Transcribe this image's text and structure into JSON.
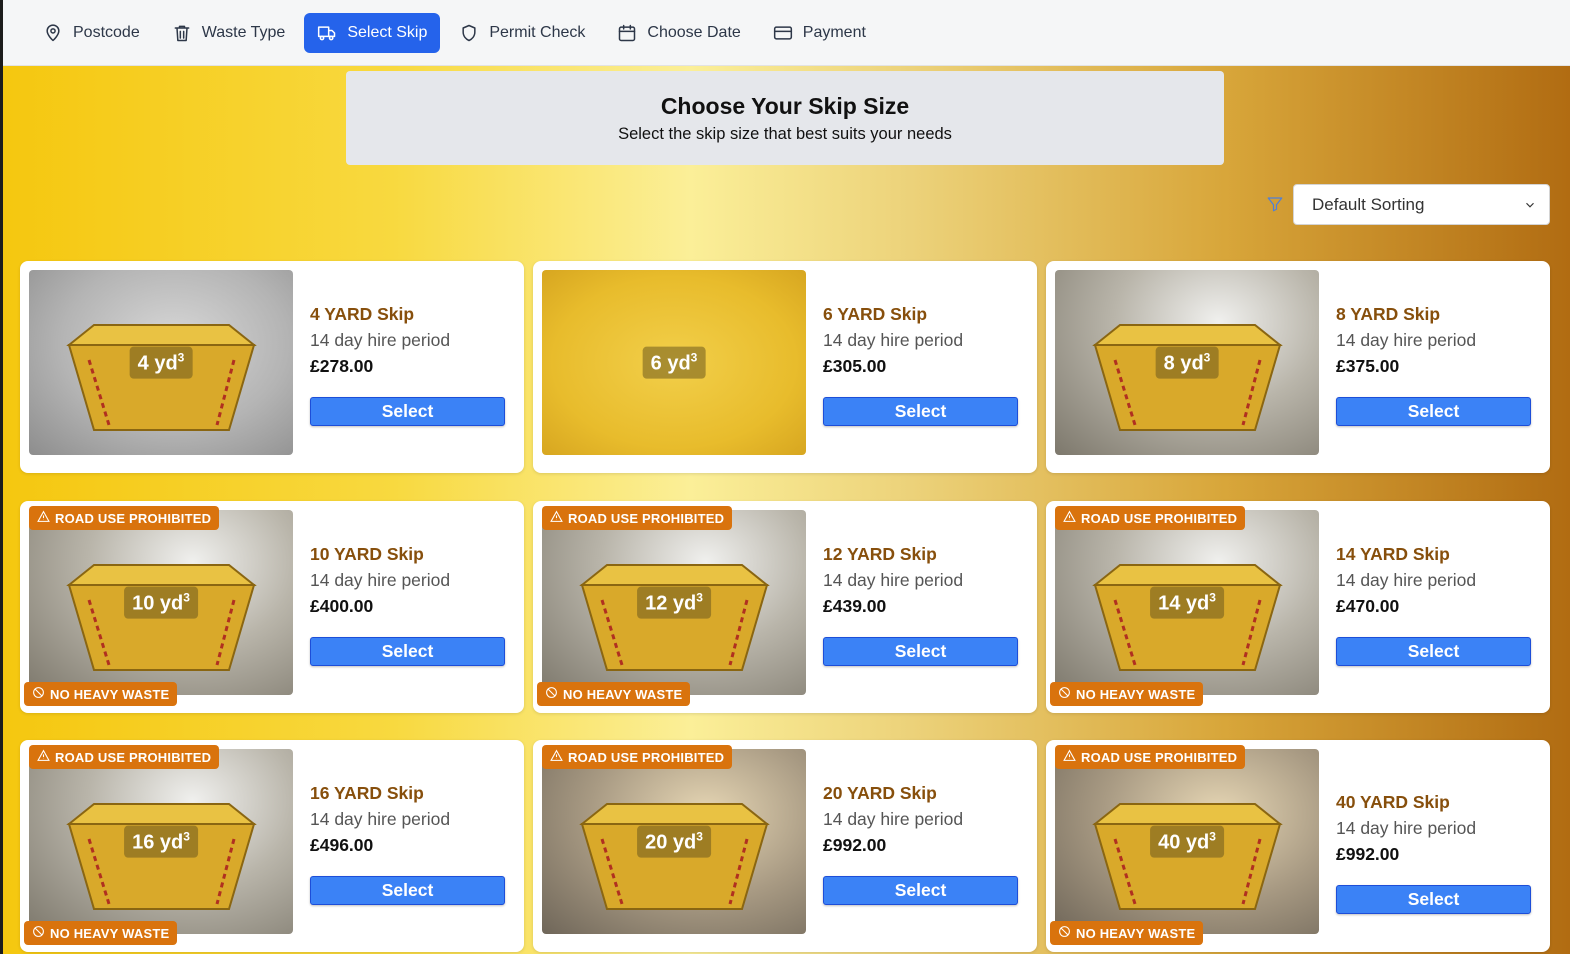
{
  "steps": [
    {
      "label": "Postcode",
      "icon": "map-pin-icon",
      "active": false
    },
    {
      "label": "Waste Type",
      "icon": "trash-icon",
      "active": false
    },
    {
      "label": "Select Skip",
      "icon": "truck-icon",
      "active": true
    },
    {
      "label": "Permit Check",
      "icon": "shield-icon",
      "active": false
    },
    {
      "label": "Choose Date",
      "icon": "calendar-icon",
      "active": false
    },
    {
      "label": "Payment",
      "icon": "credit-card-icon",
      "active": false
    }
  ],
  "header": {
    "title": "Choose Your Skip Size",
    "subtitle": "Select the skip size that best suits your needs"
  },
  "sort": {
    "selected": "Default Sorting"
  },
  "colors": {
    "accent": "#2563eb",
    "button": "#3b82f6",
    "badge": "#d9730d",
    "title": "#874f0c"
  },
  "badges": {
    "road": "ROAD USE PROHIBITED",
    "heavy": "NO HEAVY WASTE"
  },
  "skips": [
    {
      "title": "4 YARD Skip",
      "period": "14 day hire period",
      "price": "£278.00",
      "size": "4 yd",
      "sup": "3",
      "road": false,
      "heavy": false,
      "button": "Select"
    },
    {
      "title": "6 YARD Skip",
      "period": "14 day hire period",
      "price": "£305.00",
      "size": "6 yd",
      "sup": "3",
      "road": false,
      "heavy": false,
      "button": "Select"
    },
    {
      "title": "8 YARD Skip",
      "period": "14 day hire period",
      "price": "£375.00",
      "size": "8 yd",
      "sup": "3",
      "road": false,
      "heavy": false,
      "button": "Select"
    },
    {
      "title": "10 YARD Skip",
      "period": "14 day hire period",
      "price": "£400.00",
      "size": "10 yd",
      "sup": "3",
      "road": true,
      "heavy": true,
      "button": "Select"
    },
    {
      "title": "12 YARD Skip",
      "period": "14 day hire period",
      "price": "£439.00",
      "size": "12 yd",
      "sup": "3",
      "road": true,
      "heavy": true,
      "button": "Select"
    },
    {
      "title": "14 YARD Skip",
      "period": "14 day hire period",
      "price": "£470.00",
      "size": "14 yd",
      "sup": "3",
      "road": true,
      "heavy": true,
      "button": "Select"
    },
    {
      "title": "16 YARD Skip",
      "period": "14 day hire period",
      "price": "£496.00",
      "size": "16 yd",
      "sup": "3",
      "road": true,
      "heavy": true,
      "button": "Select"
    },
    {
      "title": "20 YARD Skip",
      "period": "14 day hire period",
      "price": "£992.00",
      "size": "20 yd",
      "sup": "3",
      "road": true,
      "heavy": false,
      "button": "Select"
    },
    {
      "title": "40 YARD Skip",
      "period": "14 day hire period",
      "price": "£992.00",
      "size": "40 yd",
      "sup": "3",
      "road": true,
      "heavy": true,
      "button": "Select"
    }
  ]
}
